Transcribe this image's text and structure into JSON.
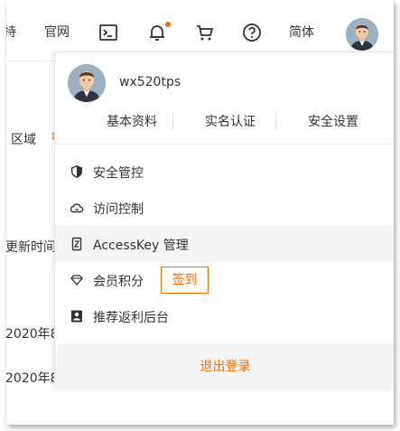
{
  "topbar": {
    "cut_label": "持",
    "official_site": "官网",
    "lang": "简体",
    "icons": [
      "terminal-icon",
      "bell-icon",
      "cart-icon",
      "help-icon"
    ],
    "notification_dot_color": "#ff6a00"
  },
  "background": {
    "region_label": "区域",
    "update_time_label": "更新时间",
    "row_dates": [
      "2020年8",
      "2020年8"
    ]
  },
  "dropdown": {
    "username": "wx520tps",
    "quick_links": [
      "基本资料",
      "实名认证",
      "安全设置"
    ],
    "menu": [
      {
        "label": "安全管控",
        "icon": "shield-icon"
      },
      {
        "label": "访问控制",
        "icon": "cloud-icon"
      },
      {
        "label": "AccessKey 管理",
        "icon": "key-icon"
      },
      {
        "label": "会员积分",
        "icon": "diamond-icon",
        "badge": "签到"
      },
      {
        "label": "推荐返利后台",
        "icon": "rebate-icon"
      }
    ],
    "logout": "退出登录"
  },
  "colors": {
    "accent": "#ff6a00",
    "hover_bg": "#f5f5f5"
  }
}
